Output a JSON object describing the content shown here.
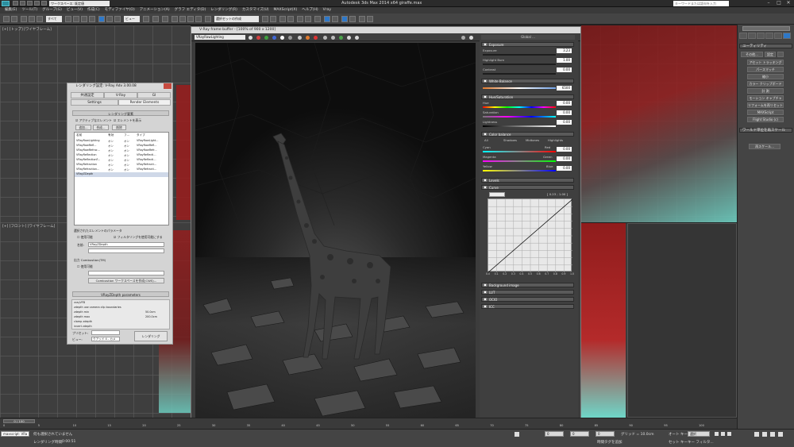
{
  "window": {
    "title": "Autodesk 3ds Max 2014 x64     giraffe.max",
    "workspace_label": "ワークスペース: 既定値",
    "help_search_placeholder": "キーワードまたは語句を入力"
  },
  "menu": [
    "編集(E)",
    "ツール(T)",
    "グループ(G)",
    "ビュー(V)",
    "作成(C)",
    "モディファイヤ(O)",
    "アニメーション(A)",
    "グラフ エディタ(D)",
    "レンダリング(R)",
    "カスタマイズ(U)",
    "MAXScript(X)",
    "ヘルプ(H)",
    "Vray"
  ],
  "toolbar": {
    "filter": "すべて",
    "view_combo": "ビュー",
    "selection_set": "選択セットの作成"
  },
  "viewports": {
    "top_left_label": "[+] [トップ] [ワイヤフレーム]",
    "bottom_left_label": "[+] [フロント] [ワイヤフレーム]"
  },
  "command_panel": {
    "rollout_utility": "ユーティリティ",
    "more": "その他...",
    "sets": "設定",
    "buttons": [
      "アセット トラッキング",
      "パースマッチ",
      "縮小",
      "カラー クリップボード",
      "計 測",
      "モーション キャプチャ",
      "リフォームを再リセット",
      "MAXScript",
      "Flight Studio (c)"
    ],
    "rollout_world": "ワールド単位を再スケール",
    "rescale_button": "再スケール..."
  },
  "frame_buffer": {
    "title": "V-Ray frame buffer - [100% of 900 x 1200]",
    "channel": "VRayRawLighting",
    "panel_title": "Global ...",
    "exposure": {
      "label": "Exposure",
      "rows": [
        {
          "label": "Exposure",
          "value": "3.23"
        },
        {
          "label": "Highlight Burn",
          "value": "1.00"
        },
        {
          "label": "Contrast",
          "value": "0.00"
        }
      ]
    },
    "white_balance": {
      "label": "White Balance",
      "value": "6500"
    },
    "hue_sat": {
      "label": "Hue/Saturation",
      "rows": [
        {
          "label": "Hue",
          "value": "0.00"
        },
        {
          "label": "Saturation",
          "value": "0.00"
        },
        {
          "label": "Lightness",
          "value": "0.00"
        }
      ]
    },
    "color_balance": {
      "label": "Color balance",
      "options": [
        "All",
        "Shadows",
        "Midtones",
        "Highlights"
      ],
      "rows": [
        {
          "label": "Cyan",
          "right": "Red",
          "value": "0.00"
        },
        {
          "label": "Magenta",
          "right": "Green",
          "value": "0.00"
        },
        {
          "label": "Yellow",
          "right": "Blue",
          "value": "0.00"
        }
      ]
    },
    "levels": "Levels",
    "curve": {
      "label": "Curve",
      "readout": "[ 0.23 ; 1.00 ]",
      "ticks": [
        "0.0",
        "0.1",
        "0.2",
        "0.3",
        "0.4",
        "0.5",
        "0.6",
        "0.7",
        "0.8",
        "0.9",
        "1.0"
      ]
    },
    "background_image": "Background image",
    "lut": "LUT",
    "ocio": "OCIO",
    "icc": "ICC"
  },
  "render_dialog": {
    "title": "レンダリング設定: V-Ray Adv 3.00.08",
    "tabs_row1": [
      "共通設定",
      "V-Ray",
      "GI"
    ],
    "tabs_row2": [
      "Settings",
      "Render Elements"
    ],
    "section_title": "レンダリング要素",
    "opt_active": "アクティブなエレメント",
    "opt_show": "エレメントを表示",
    "btn_add": "追加...",
    "btn_merge": "合成...",
    "btn_delete": "削除",
    "list_headers": [
      "名前",
      "有効",
      "フ...",
      "タイプ"
    ],
    "elements": [
      [
        "VRayRawLighting",
        "オン",
        "オン",
        "VRayRawLight..."
      ],
      [
        "VRayRawRefl...",
        "オン",
        "オン",
        "VRayRawRefl..."
      ],
      [
        "VRayRawRefrac...",
        "オン",
        "オン",
        "VRayRawRefr..."
      ],
      [
        "VRayReflection",
        "オン",
        "オン",
        "VRayReflecti..."
      ],
      [
        "VRayReflectionF...",
        "オン",
        "オン",
        "VRayReflecti..."
      ],
      [
        "VRayRefraction",
        "オン",
        "オン",
        "VRayRefracti..."
      ],
      [
        "VRayRefraction...",
        "オン",
        "オン",
        "VRayRefracti..."
      ],
      [
        "VRayZDepth",
        "",
        "",
        ""
      ]
    ],
    "selected_params": "選択されたエレメントのパラメータ",
    "enable": "使用可能",
    "enable_filter": "フィルタリングを使用可能にする",
    "name_label": "名前:",
    "name_value": "VRayZDepth",
    "output_combustion": "出力 Combustion(TM)",
    "enable2": "使用可能",
    "combustion_btn": "Combustion ワークスペースを作成(CWS)...",
    "zdepth_rollout": "VRayZDepth parameters",
    "zdepth_params": [
      [
        "vrayVFB",
        ""
      ],
      [
        "zdepth use camera clip boundaries",
        ""
      ],
      [
        "zdepth min",
        "50.0cm"
      ],
      [
        "zdepth max",
        "200.0cm"
      ],
      [
        "clamp zdepth",
        ""
      ],
      [
        "invert zdepth",
        ""
      ]
    ],
    "preset_label": "プリセット:",
    "view_label": "ビュー:",
    "view_value": "クアッド 4 - カメ",
    "render_btn": "レンダリング"
  },
  "timeline": {
    "frame_range": "0 / 100",
    "ticks": [
      "0",
      "5",
      "10",
      "15",
      "20",
      "25",
      "30",
      "35",
      "40",
      "45",
      "50",
      "55",
      "60",
      "65",
      "70",
      "75",
      "80",
      "85",
      "90",
      "95",
      "100"
    ]
  },
  "status": {
    "script_listener": "maxscript: VRa",
    "none_selected": "何も選択されていません",
    "render_time_label": "レンダリング時間:",
    "render_time": "0:00:51",
    "grid": "グリッド = 10.0cm",
    "auto_key": "オート キー",
    "selected": "選択",
    "set_key": "セット キー",
    "key_filter": "キー フィルタ...",
    "add_time_tag": "時間タグを追加",
    "coord": "0"
  },
  "colors": {
    "accent_blue": "#2e78c8",
    "red_points": "#b51e1e",
    "cyan_points": "#6fd6c8"
  }
}
